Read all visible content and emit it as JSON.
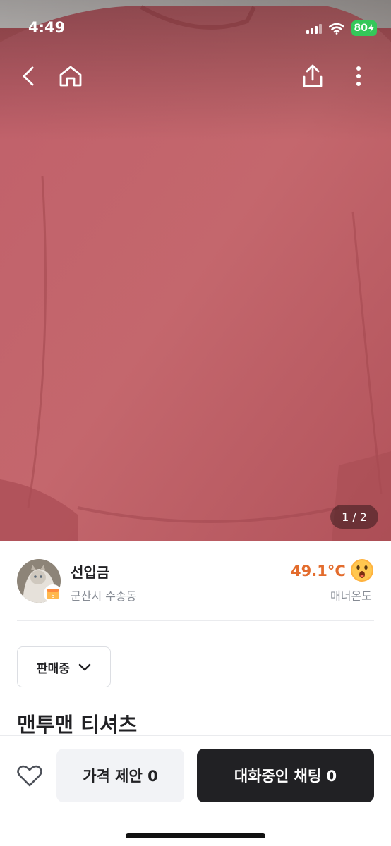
{
  "status_bar": {
    "time": "4:49",
    "battery_level": "80",
    "icons": [
      "signal-icon",
      "wifi-icon",
      "battery-icon"
    ]
  },
  "top_nav": {
    "icons": [
      "back-chevron-icon",
      "home-icon",
      "share-icon",
      "more-vertical-icon"
    ]
  },
  "photo": {
    "current": "1",
    "separator": "/",
    "total": "2"
  },
  "seller": {
    "name": "선입금",
    "location": "군산시 수송동",
    "temperature": "49.1°C",
    "manner_label": "매너온도",
    "temperature_color": "#e36c2d"
  },
  "listing": {
    "status": "판매중",
    "title": "맨투맨 티셔츠"
  },
  "bottom_bar": {
    "offer_label": "가격 제안 0",
    "chat_label": "대화중인 채팅 0"
  },
  "colors": {
    "primary_dark": "#212124",
    "muted_text": "#868b94",
    "accent_orange": "#e36c2d",
    "battery_green": "#34c759"
  }
}
